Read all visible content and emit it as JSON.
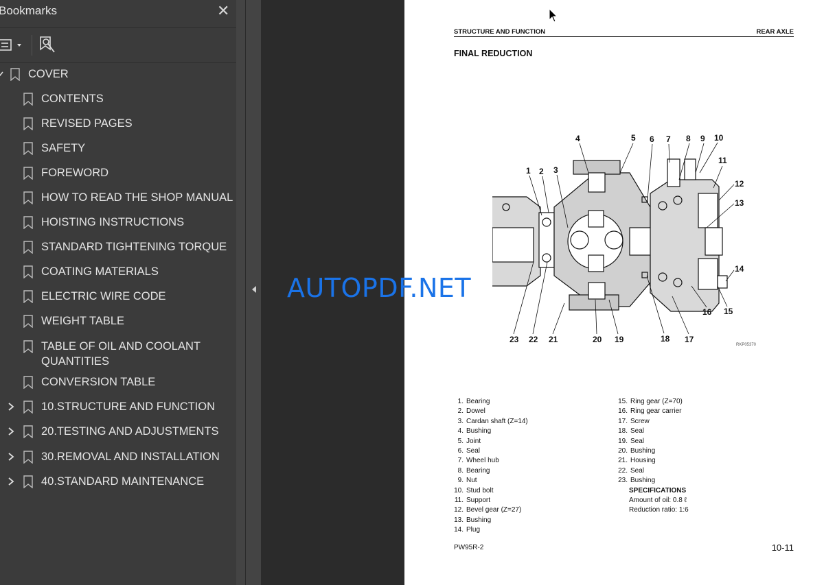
{
  "sidebar": {
    "title": "Bookmarks",
    "close": "✕",
    "items": [
      {
        "label": "COVER",
        "level": 0,
        "expandable": false,
        "expanded": true
      },
      {
        "label": "CONTENTS",
        "level": 1
      },
      {
        "label": "REVISED PAGES",
        "level": 1
      },
      {
        "label": "SAFETY",
        "level": 1
      },
      {
        "label": "FOREWORD",
        "level": 1
      },
      {
        "label": "HOW TO READ THE SHOP MANUAL",
        "level": 1
      },
      {
        "label": "HOISTING INSTRUCTIONS",
        "level": 1
      },
      {
        "label": "STANDARD TIGHTENING TORQUE",
        "level": 1
      },
      {
        "label": "COATING MATERIALS",
        "level": 1
      },
      {
        "label": "ELECTRIC WIRE CODE",
        "level": 1
      },
      {
        "label": "WEIGHT TABLE",
        "level": 1
      },
      {
        "label": "TABLE OF OIL AND COOLANT",
        "label2": "QUANTITIES",
        "level": 1
      },
      {
        "label": "CONVERSION TABLE",
        "level": 1
      },
      {
        "label": "10.STRUCTURE AND FUNCTION",
        "level": 1,
        "expandable": true
      },
      {
        "label": "20.TESTING AND ADJUSTMENTS",
        "level": 1,
        "expandable": true
      },
      {
        "label": "30.REMOVAL AND INSTALLATION",
        "level": 1,
        "expandable": true
      },
      {
        "label": "40.STANDARD MAINTENANCE",
        "level": 1,
        "expandable": true
      }
    ]
  },
  "page": {
    "header_left": "STRUCTURE AND FUNCTION",
    "header_right": "REAR AXLE",
    "section_title": "FINAL REDUCTION",
    "figure_code": "RKP05370",
    "callouts_top": [
      "4",
      "5",
      "6",
      "7",
      "8",
      "9",
      "10",
      "11",
      "12",
      "13",
      "1",
      "2",
      "3",
      "14"
    ],
    "callouts_bottom": [
      "23",
      "22",
      "21",
      "20",
      "19",
      "18",
      "17",
      "16",
      "15"
    ],
    "parts_left": [
      {
        "n": "1.",
        "t": "Bearing"
      },
      {
        "n": "2.",
        "t": "Dowel"
      },
      {
        "n": "3.",
        "t": "Cardan shaft (Z=14)"
      },
      {
        "n": "4.",
        "t": "Bushing"
      },
      {
        "n": "5.",
        "t": "Joint"
      },
      {
        "n": "6.",
        "t": "Seal"
      },
      {
        "n": "7.",
        "t": "Wheel hub"
      },
      {
        "n": "8.",
        "t": "Bearing"
      },
      {
        "n": "9.",
        "t": "Nut"
      },
      {
        "n": "10.",
        "t": "Stud bolt"
      },
      {
        "n": "11.",
        "t": "Support"
      },
      {
        "n": "12.",
        "t": "Bevel gear (Z=27)"
      },
      {
        "n": "13.",
        "t": "Bushing"
      },
      {
        "n": "14.",
        "t": "Plug"
      }
    ],
    "parts_right": [
      {
        "n": "15.",
        "t": "Ring gear (Z=70)"
      },
      {
        "n": "16.",
        "t": "Ring gear carrier"
      },
      {
        "n": "17.",
        "t": "Screw"
      },
      {
        "n": "18.",
        "t": "Seal"
      },
      {
        "n": "19.",
        "t": "Seal"
      },
      {
        "n": "20.",
        "t": "Bushing"
      },
      {
        "n": "21.",
        "t": "Housing"
      },
      {
        "n": "22.",
        "t": "Seal"
      },
      {
        "n": "23.",
        "t": "Bushing"
      }
    ],
    "specs_title": "SPECIFICATIONS",
    "spec_oil": "Amount of oil: 0.8 ℓ",
    "spec_ratio": "Reduction ratio: 1:6",
    "footer_left": "PW95R-2",
    "footer_right": "10-11"
  },
  "watermark": "AUTOPDF.NET"
}
